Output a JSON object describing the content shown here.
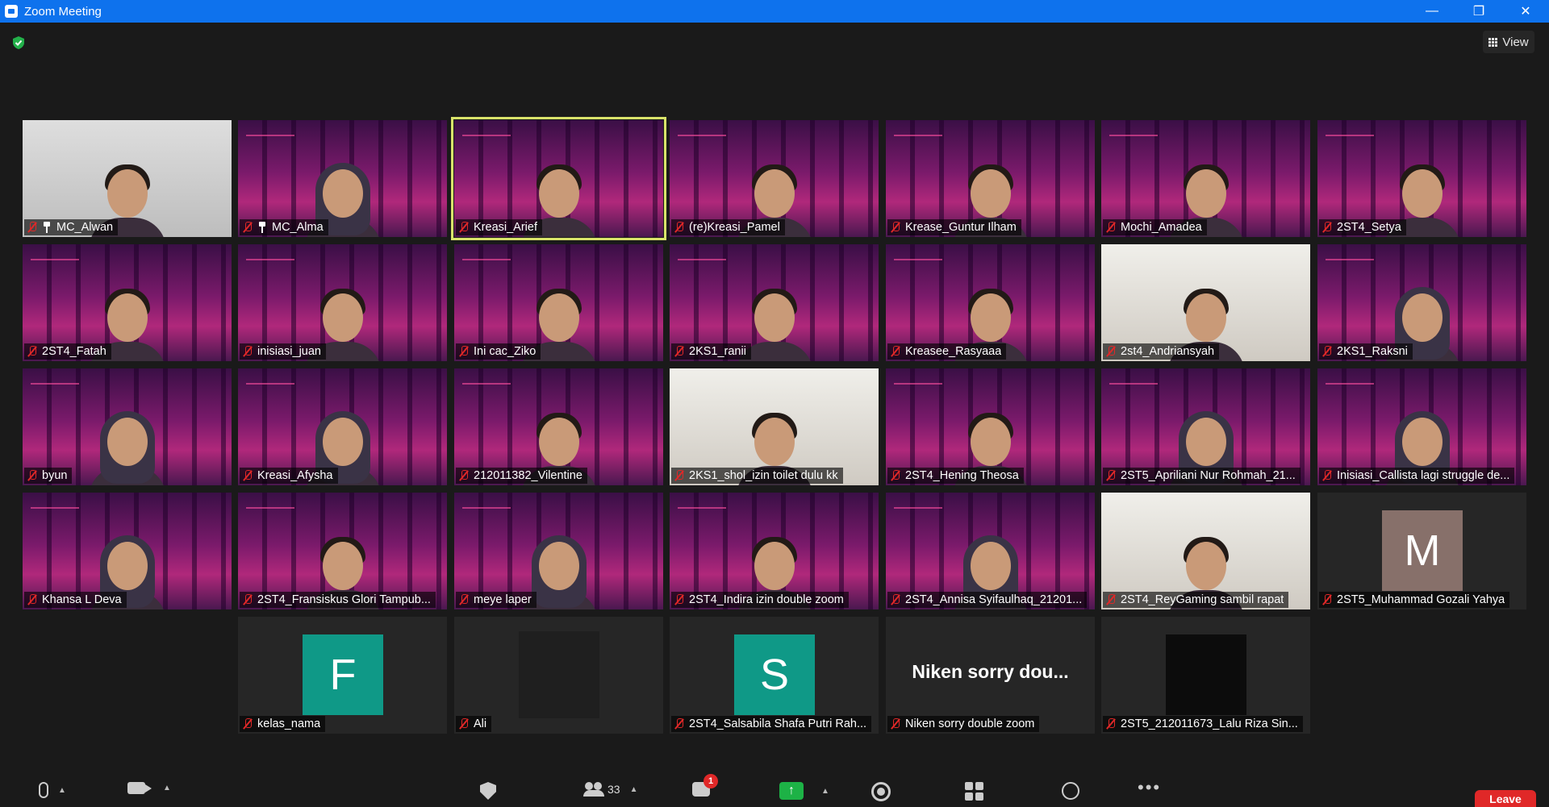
{
  "window": {
    "title": "Zoom Meeting",
    "min": "—",
    "restore": "❐",
    "close": "✕"
  },
  "view_label": "View",
  "tiles": [
    {
      "name": "MC_Alwan",
      "bg": "photo",
      "pin": true
    },
    {
      "name": "MC_Alma",
      "bg": "vbg",
      "pin": true,
      "hijab": true
    },
    {
      "name": "Kreasi_Arief",
      "bg": "vbg",
      "active": true
    },
    {
      "name": "(re)Kreasi_Pamel",
      "bg": "vbg"
    },
    {
      "name": "Krease_Guntur Ilham",
      "bg": "vbg"
    },
    {
      "name": "Mochi_Amadea",
      "bg": "vbg"
    },
    {
      "name": "2ST4_Setya",
      "bg": "vbg"
    },
    {
      "name": "2ST4_Fatah",
      "bg": "vbg"
    },
    {
      "name": "inisiasi_juan",
      "bg": "vbg"
    },
    {
      "name": "Ini cac_Ziko",
      "bg": "vbg"
    },
    {
      "name": "2KS1_ranii",
      "bg": "vbg"
    },
    {
      "name": "Kreasee_Rasyaaa",
      "bg": "vbg"
    },
    {
      "name": "2st4_Andriansyah",
      "bg": "photo2"
    },
    {
      "name": "2KS1_Raksni",
      "bg": "vbg",
      "hijab": true
    },
    {
      "name": "byun",
      "bg": "vbg",
      "hijab": true
    },
    {
      "name": "Kreasi_Afysha",
      "bg": "vbg",
      "hijab": true
    },
    {
      "name": "212011382_Vilentine",
      "bg": "vbg"
    },
    {
      "name": "2KS1_shol_izin toilet dulu kk",
      "bg": "photo2"
    },
    {
      "name": "2ST4_Hening Theosa",
      "bg": "vbg"
    },
    {
      "name": "2ST5_Apriliani Nur Rohmah_21...",
      "bg": "vbg",
      "hijab": true
    },
    {
      "name": "Inisiasi_Callista lagi struggle de...",
      "bg": "vbg",
      "hijab": true
    },
    {
      "name": "Khansa L Deva",
      "bg": "vbg",
      "hijab": true
    },
    {
      "name": "2ST4_Fransiskus Glori Tampub...",
      "bg": "vbg"
    },
    {
      "name": "meye laper",
      "bg": "vbg",
      "hijab": true
    },
    {
      "name": "2ST4_Indira izin double zoom",
      "bg": "vbg"
    },
    {
      "name": "2ST4_Annisa Syifaulhaq_21201...",
      "bg": "vbg",
      "hijab": true
    },
    {
      "name": "2ST4_ReyGaming sambil rapat",
      "bg": "photo2"
    },
    {
      "name": "2ST5_Muhammad Gozali Yahya",
      "bg": "avatar",
      "letter": "M",
      "color": "brown"
    },
    {
      "name": "kelas_nama",
      "bg": "avatar",
      "letter": "F",
      "color": "teal"
    },
    {
      "name": "Ali",
      "bg": "dark"
    },
    {
      "name": "2ST4_Salsabila Shafa Putri Rah...",
      "bg": "avatar",
      "letter": "S",
      "color": "teal"
    },
    {
      "name": "Niken sorry double zoom",
      "bg": "text",
      "big_text": "Niken sorry dou..."
    },
    {
      "name": "2ST5_212011673_Lalu Riza Sin...",
      "bg": "black"
    }
  ],
  "toolbar": {
    "participants_count": "33",
    "chat_badge": "1",
    "leave_label": "Leave",
    "share_arrow": "↑",
    "more_label": "•••"
  },
  "colors": {
    "titlebar": "#0e72ed",
    "active_border": "#d9e36a",
    "leave": "#e02828",
    "share": "#1db246"
  }
}
